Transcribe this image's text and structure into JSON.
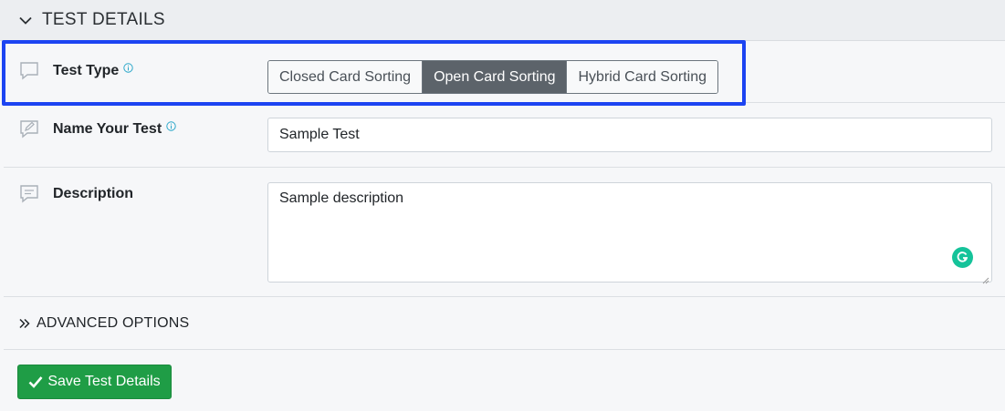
{
  "section": {
    "title": "TEST DETAILS",
    "icon": "chevron-down-icon"
  },
  "test_type": {
    "label": "Test Type",
    "icon": "speech-bubble-icon",
    "info_icon": "info-icon",
    "options": [
      {
        "label": "Closed Card Sorting",
        "active": false
      },
      {
        "label": "Open Card Sorting",
        "active": true
      },
      {
        "label": "Hybrid Card Sorting",
        "active": false
      }
    ],
    "selected": "Open Card Sorting",
    "highlight_color": "#1c44f2"
  },
  "name_test": {
    "label": "Name Your Test",
    "icon": "edit-bubble-icon",
    "info_icon": "info-icon",
    "value": "Sample Test"
  },
  "description": {
    "label": "Description",
    "icon": "message-lines-icon",
    "value": "Sample description",
    "grammarly_icon": "grammarly-icon"
  },
  "advanced": {
    "label": "ADVANCED OPTIONS",
    "icon": "double-chevron-right-icon"
  },
  "save": {
    "label": "Save Test Details",
    "icon": "check-icon",
    "color": "#1f9d46"
  }
}
